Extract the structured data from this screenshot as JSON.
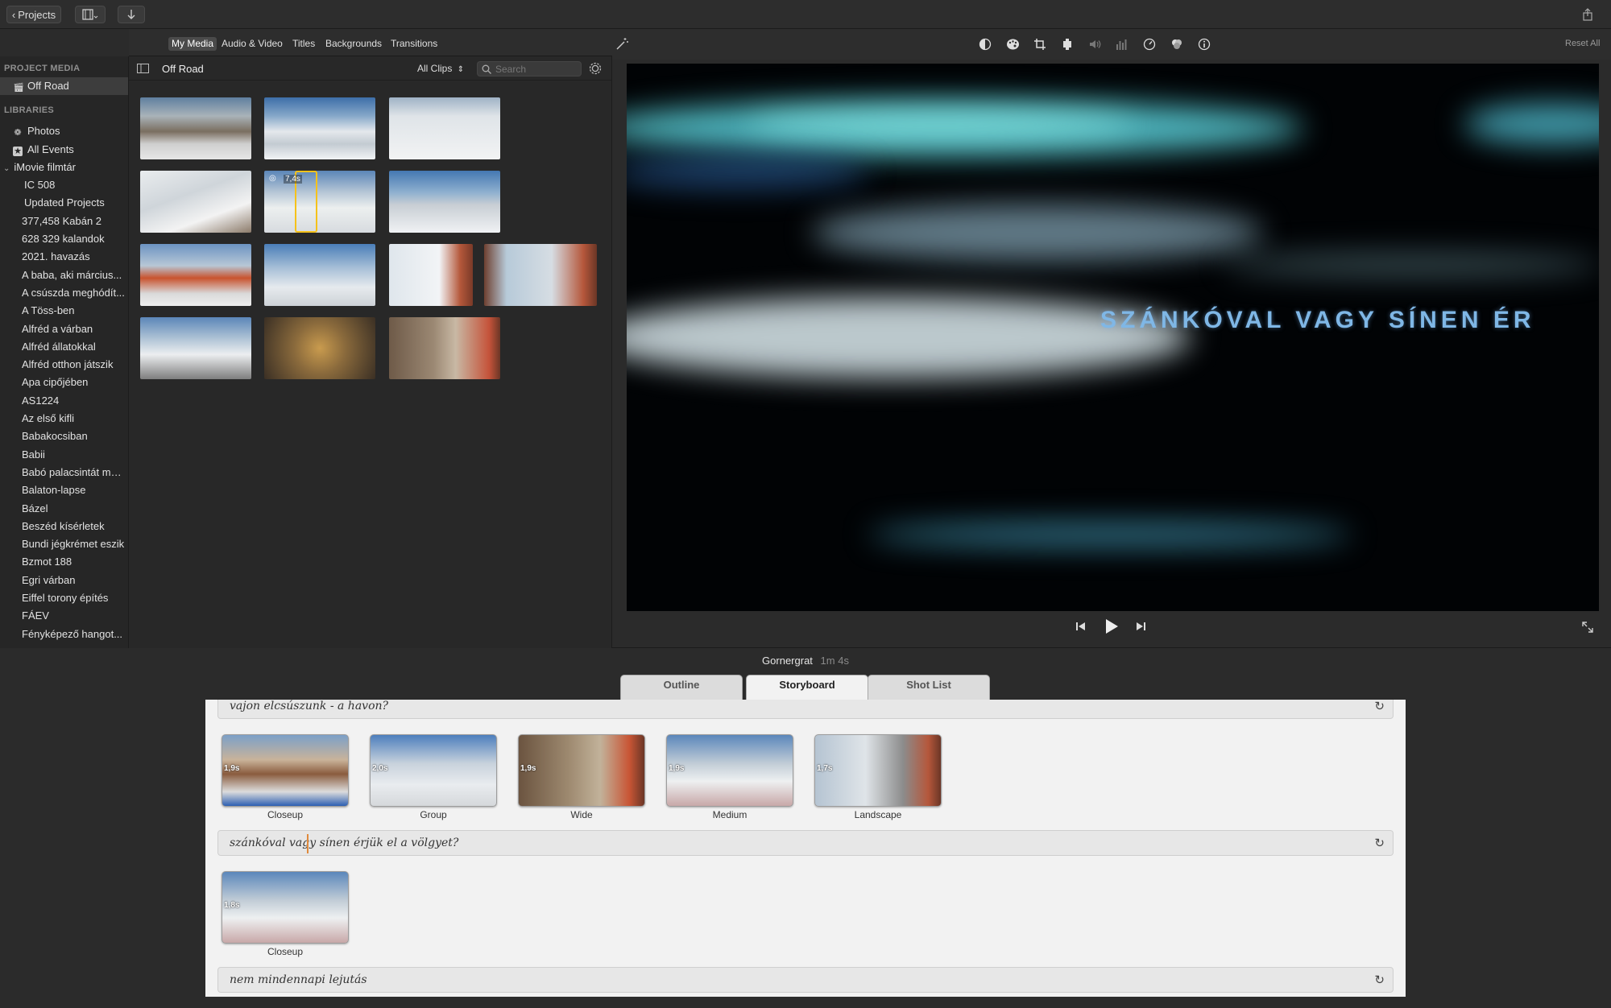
{
  "toolbar": {
    "projects_label": "Projects",
    "share_icon": "share-icon",
    "import_icon": "download-arrow-icon",
    "media_view_icon": "film-grid-icon"
  },
  "media_tabs": [
    "My Media",
    "Audio & Video",
    "Titles",
    "Backgrounds",
    "Transitions"
  ],
  "sidebar": {
    "project_media_header": "PROJECT MEDIA",
    "project_item": "Off Road",
    "libraries_header": "LIBRARIES",
    "photos": "Photos",
    "all_events": "All Events",
    "library_name": "iMovie filmtár",
    "events": [
      "IC 508",
      "Updated Projects",
      "377,458 Kabán 2",
      "628 329 kalandok",
      "2021. havazás",
      "A baba, aki március...",
      "A csúszda meghódít...",
      "A Töss-ben",
      "Alfréd a várban",
      "Alfréd állatokkal",
      "Alfréd otthon játszik",
      "Apa cipőjében",
      "AS1224",
      "Az első kifli",
      "Babakocsiban",
      "Babii",
      "Babó palacsintát ma...",
      "Balaton-lapse",
      "Bázel",
      "Beszéd kísérletek",
      "Bundi jégkrémet eszik",
      "Bzmot 188",
      "Egri várban",
      "Eiffel torony építés",
      "FÁEV",
      "Fényképező hangot..."
    ]
  },
  "browser": {
    "title": "Off Road",
    "filter": "All Clips",
    "search_placeholder": "Search",
    "selected_duration": "7,4s"
  },
  "viewer": {
    "reset_all": "Reset All",
    "title_text": "SZÁNKÓVAL VAGY SÍNEN ÉR"
  },
  "project": {
    "name": "Gornergrat",
    "duration": "1m 4s"
  },
  "storyboard_tabs": [
    "Outline",
    "Storyboard",
    "Shot List"
  ],
  "storyboard": {
    "section1": "vajon elcsúszunk - a havon?",
    "section2": "szánkóval vagy sínen érjük el a völgyet?",
    "section3": "nem mindennapi lejutás",
    "clips1": [
      {
        "dur": "1,9s",
        "label": "Closeup"
      },
      {
        "dur": "2,0s",
        "label": "Group"
      },
      {
        "dur": "1,9s",
        "label": "Wide"
      },
      {
        "dur": "1,9s",
        "label": "Medium"
      },
      {
        "dur": "1,7s",
        "label": "Landscape"
      }
    ],
    "clips2": [
      {
        "dur": "1,8s",
        "label": "Closeup"
      }
    ]
  }
}
